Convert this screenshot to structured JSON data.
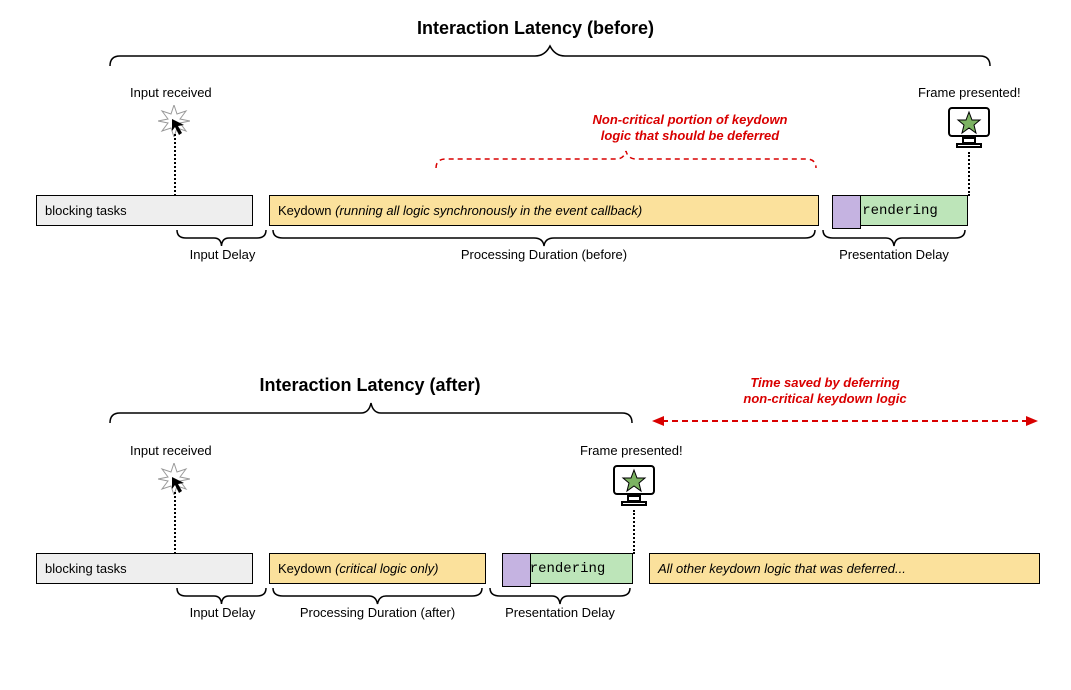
{
  "before": {
    "title": "Interaction Latency (before)",
    "inputReceived": "Input received",
    "framePresented": "Frame presented!",
    "redNote": "Non-critical portion of keydown\nlogic that should be deferred",
    "blocking": "blocking tasks",
    "keydownPrefix": "Keydown ",
    "keydownItalic": "(running all logic synchronously in the event callback)",
    "rendering": "rendering",
    "inputDelay": "Input Delay",
    "processing": "Processing Duration (before)",
    "presentation": "Presentation Delay"
  },
  "after": {
    "title": "Interaction Latency (after)",
    "redNote": "Time saved by deferring\nnon-critical keydown logic",
    "inputReceived": "Input received",
    "framePresented": "Frame presented!",
    "blocking": "blocking tasks",
    "keydownPrefix": "Keydown ",
    "keydownItalic": "(critical logic only)",
    "rendering": "rendering",
    "deferred": "All other keydown logic that was deferred...",
    "inputDelay": "Input Delay",
    "processing": "Processing Duration (after)",
    "presentation": "Presentation Delay"
  }
}
